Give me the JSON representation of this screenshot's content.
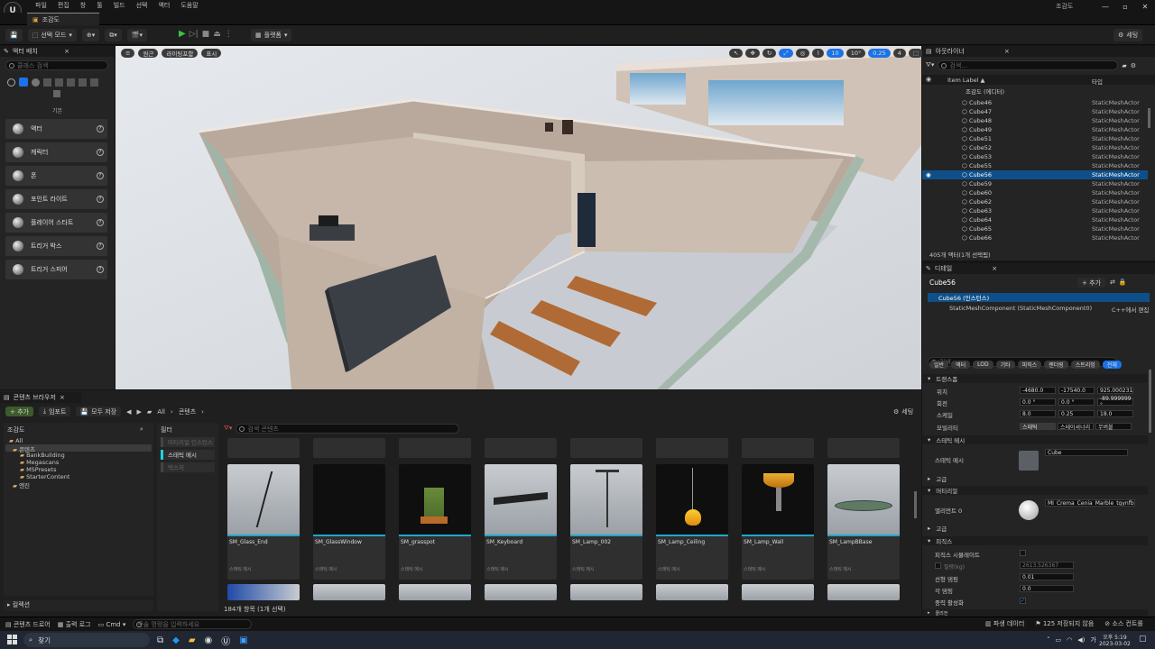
{
  "app": {
    "logo": "U",
    "project_name": "조감도",
    "map_tab": "조감도"
  },
  "menu": [
    "파일",
    "편집",
    "창",
    "툴",
    "빌드",
    "선택",
    "액터",
    "도움말"
  ],
  "window_controls": [
    "—",
    "▫",
    "✕"
  ],
  "toolbar": {
    "select_mode": "선택 모드",
    "platforms": "플랫폼",
    "settings": "세팅"
  },
  "place_actors": {
    "title": "액터 배치",
    "search_placeholder": "클래스 검색",
    "category_label": "기본",
    "items": [
      {
        "label": "액터",
        "icon": "sphere-icon"
      },
      {
        "label": "캐릭터",
        "icon": "character-icon"
      },
      {
        "label": "폰",
        "icon": "pawn-icon"
      },
      {
        "label": "포인트 라이트",
        "icon": "light-bulb-icon"
      },
      {
        "label": "플레이어 스타트",
        "icon": "player-start-icon"
      },
      {
        "label": "트리거 박스",
        "icon": "box-icon"
      },
      {
        "label": "트리거 스피어",
        "icon": "sphere-icon"
      }
    ]
  },
  "viewport": {
    "buttons": [
      "원근",
      "라이팅포함",
      "표시"
    ],
    "grid_snap": "10",
    "rot_snap": "10°",
    "scale_snap": "0.25",
    "cam_speed": "4"
  },
  "outliner": {
    "title": "아웃라이너",
    "search_placeholder": "검색...",
    "col_label": "Item Label ▲",
    "col_type": "타입",
    "root": "조감도 (에디터)",
    "rows": [
      {
        "label": "Cube46",
        "type": "StaticMeshActor"
      },
      {
        "label": "Cube47",
        "type": "StaticMeshActor"
      },
      {
        "label": "Cube48",
        "type": "StaticMeshActor"
      },
      {
        "label": "Cube49",
        "type": "StaticMeshActor"
      },
      {
        "label": "Cube51",
        "type": "StaticMeshActor"
      },
      {
        "label": "Cube52",
        "type": "StaticMeshActor"
      },
      {
        "label": "Cube53",
        "type": "StaticMeshActor"
      },
      {
        "label": "Cube55",
        "type": "StaticMeshActor"
      },
      {
        "label": "Cube56",
        "type": "StaticMeshActor",
        "selected": true
      },
      {
        "label": "Cube59",
        "type": "StaticMeshActor"
      },
      {
        "label": "Cube60",
        "type": "StaticMeshActor"
      },
      {
        "label": "Cube62",
        "type": "StaticMeshActor"
      },
      {
        "label": "Cube63",
        "type": "StaticMeshActor"
      },
      {
        "label": "Cube64",
        "type": "StaticMeshActor"
      },
      {
        "label": "Cube65",
        "type": "StaticMeshActor"
      },
      {
        "label": "Cube66",
        "type": "StaticMeshActor"
      }
    ],
    "status": "405개 액터(1개 선택됨)"
  },
  "details": {
    "title": "디테일",
    "actor_name": "Cube56",
    "add_button": "+ 추가",
    "instance_label": "Cube56 (인스턴스)",
    "component_label": "StaticMeshComponent (StaticMeshComponent0)",
    "cpp_edit": "C++에서 편집",
    "search_placeholder": "검색",
    "filter_tabs": [
      "일반",
      "액터",
      "LOD",
      "기타",
      "피직스",
      "렌더링",
      "스트리밍",
      "전체"
    ],
    "transform_header": "트랜스폼",
    "location_label": "위치",
    "rotation_label": "회전",
    "scale_label": "스케일",
    "location": [
      "-4680.0",
      "-17540.0",
      "925.000231"
    ],
    "rotation": [
      "0.0 °",
      "0.0 °",
      "-89.999999 °"
    ],
    "scale": [
      "8.0",
      "0.25",
      "18.0"
    ],
    "mobility_label": "모빌리티",
    "mobility_options": [
      "스태틱",
      "스테이셔너리",
      "무버블"
    ],
    "static_mesh_header": "스태틱 메시",
    "static_mesh_label": "스태틱 메시",
    "static_mesh_value": "Cube",
    "advanced1": "고급",
    "materials_header": "머티리얼",
    "element0_label": "엘리먼트 0",
    "material_value": "MI_Crema_Cenia_Marble_tgynfbxc_2K",
    "advanced2": "고급",
    "physics_header": "피직스",
    "simulate_label": "피직스 시뮬레이트",
    "mass_label": "질량(kg)",
    "mass_value": "2613.526367",
    "linear_damping_label": "선형 댐핑",
    "linear_damping_value": "0.01",
    "angular_damping_label": "각 댐핑",
    "angular_damping_value": "0.0",
    "gravity_label": "중력 활성화",
    "collapsed_header": "콜리전"
  },
  "content_browser": {
    "tab": "콘텐츠 브라우저",
    "add_button": "+ 추가",
    "import_button": "임포트",
    "save_all_button": "모두 저장",
    "path": [
      "All",
      "콘텐츠"
    ],
    "settings": "세팅",
    "tree_root": "조감도",
    "tree": [
      "All",
      "콘텐츠",
      "BankBuilding",
      "Megascans",
      "MSPresets",
      "StarterContent",
      "엔진"
    ],
    "filters_title": "필터",
    "filters": [
      "머티리얼 인스턴스",
      "스태틱 메시",
      "텍스처"
    ],
    "search_placeholder": "검색 콘텐츠",
    "collections": "컬렉션",
    "status": "184개 항목 (1개 선택)",
    "assets": [
      {
        "name": "SM_Glass_End",
        "type": "스태틱 메시"
      },
      {
        "name": "SM_GlassWindow",
        "type": "스태틱 메시"
      },
      {
        "name": "SM_grasspot",
        "type": "스태틱 메시"
      },
      {
        "name": "SM_Keyboard",
        "type": "스태틱 메시"
      },
      {
        "name": "SM_Lamp_002",
        "type": "스태틱 메시"
      },
      {
        "name": "SM_Lamp_Ceiling",
        "type": "스태틱 메시"
      },
      {
        "name": "SM_Lamp_Wall",
        "type": "스태틱 메시"
      },
      {
        "name": "SM_LampBBase",
        "type": "스태틱 메시"
      }
    ]
  },
  "statusbar": {
    "content_drawer": "콘텐츠 드로어",
    "output_log": "출력 로그",
    "cmd": "Cmd",
    "console_placeholder": "콘솔 명령을 입력하세요",
    "derived_data": "파생 데이터",
    "unsaved": "125 저장되지 않음",
    "source_control": "소스 컨트롤"
  },
  "taskbar": {
    "search": "찾기",
    "time": "오후 5:19",
    "date": "2023-03-02"
  }
}
